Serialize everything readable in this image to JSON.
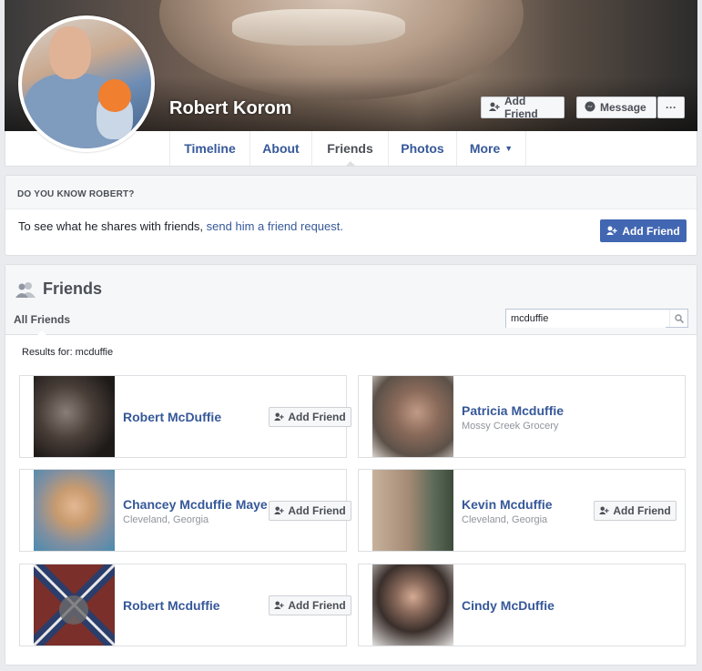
{
  "profile": {
    "name": "Robert Korom",
    "add_friend_label": "Add Friend",
    "message_label": "Message",
    "more_label": "···"
  },
  "nav": {
    "tabs": [
      {
        "label": "Timeline"
      },
      {
        "label": "About"
      },
      {
        "label": "Friends"
      },
      {
        "label": "Photos"
      },
      {
        "label": "More"
      }
    ],
    "active": "Friends"
  },
  "know": {
    "heading": "DO YOU KNOW ROBERT?",
    "text": "To see what he shares with friends, ",
    "link": "send him a friend request.",
    "button": "Add Friend"
  },
  "friends": {
    "title": "Friends",
    "tab": "All Friends",
    "search_value": "mcduffie",
    "results_label": "Results for: mcduffie",
    "add_label": "Add Friend",
    "cards": [
      {
        "name": "Robert McDuffie",
        "sub": "",
        "has_button": true
      },
      {
        "name": "Patricia Mcduffie",
        "sub": "Mossy Creek Grocery",
        "has_button": false
      },
      {
        "name": "Chancey Mcduffie Maye",
        "sub": "Cleveland, Georgia",
        "has_button": true
      },
      {
        "name": "Kevin Mcduffie",
        "sub": "Cleveland, Georgia",
        "has_button": true
      },
      {
        "name": "Robert Mcduffie",
        "sub": "",
        "has_button": true
      },
      {
        "name": "Cindy McDuffie",
        "sub": "",
        "has_button": false
      }
    ]
  },
  "colors": {
    "link": "#365899",
    "primary_button": "#4267b2",
    "background": "#e9ebee"
  }
}
